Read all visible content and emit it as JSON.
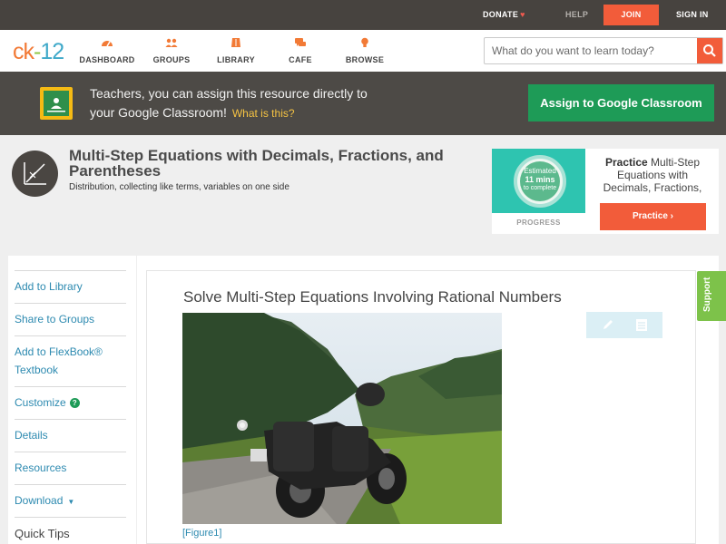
{
  "topbar": {
    "donate": "DONATE",
    "help": "HELP",
    "join": "JOIN",
    "signin": "SIGN IN"
  },
  "logo": {
    "part1": "ck",
    "part2": "-",
    "part3": "12"
  },
  "nav": {
    "items": [
      {
        "label": "DASHBOARD",
        "icon": "gauge-icon"
      },
      {
        "label": "GROUPS",
        "icon": "people-icon"
      },
      {
        "label": "LIBRARY",
        "icon": "library-icon"
      },
      {
        "label": "CAFE",
        "icon": "chat-icon"
      },
      {
        "label": "BROWSE",
        "icon": "lightbulb-icon"
      }
    ]
  },
  "search": {
    "placeholder": "What do you want to learn today?"
  },
  "banner": {
    "line1": "Teachers, you can assign this resource directly to",
    "line2": "your Google Classroom!",
    "whatis": "What is this?",
    "button": "Assign to Google Classroom"
  },
  "page": {
    "title": "Multi-Step Equations with Decimals, Fractions, and Parentheses",
    "subtitle": "Distribution, collecting like terms, variables on one side"
  },
  "practice": {
    "estimated": "Estimated",
    "mins": "11 mins",
    "to_complete": "to complete",
    "progress_label": "PROGRESS",
    "bold": "Practice",
    "text": " Multi-Step Equations with Decimals, Fractions,",
    "button": "Practice"
  },
  "sidebar": {
    "items": [
      {
        "label": "Add to Library"
      },
      {
        "label": "Share to Groups"
      },
      {
        "label": "Add to FlexBook®"
      },
      {
        "label": "Textbook"
      },
      {
        "label": "Customize"
      },
      {
        "label": "Details"
      },
      {
        "label": "Resources"
      },
      {
        "label": "Download"
      }
    ],
    "quick_tips": "Quick Tips"
  },
  "content": {
    "title": "Solve Multi-Step Equations Involving Rational Numbers",
    "figure_caption": "[Figure1]"
  },
  "support": "Support",
  "colors": {
    "accent": "#f25c3a",
    "topbar": "#47433f",
    "banner": "#4d4a46",
    "google_green": "#1e9b57",
    "link": "#2d8ab0",
    "support": "#7dc24a"
  }
}
